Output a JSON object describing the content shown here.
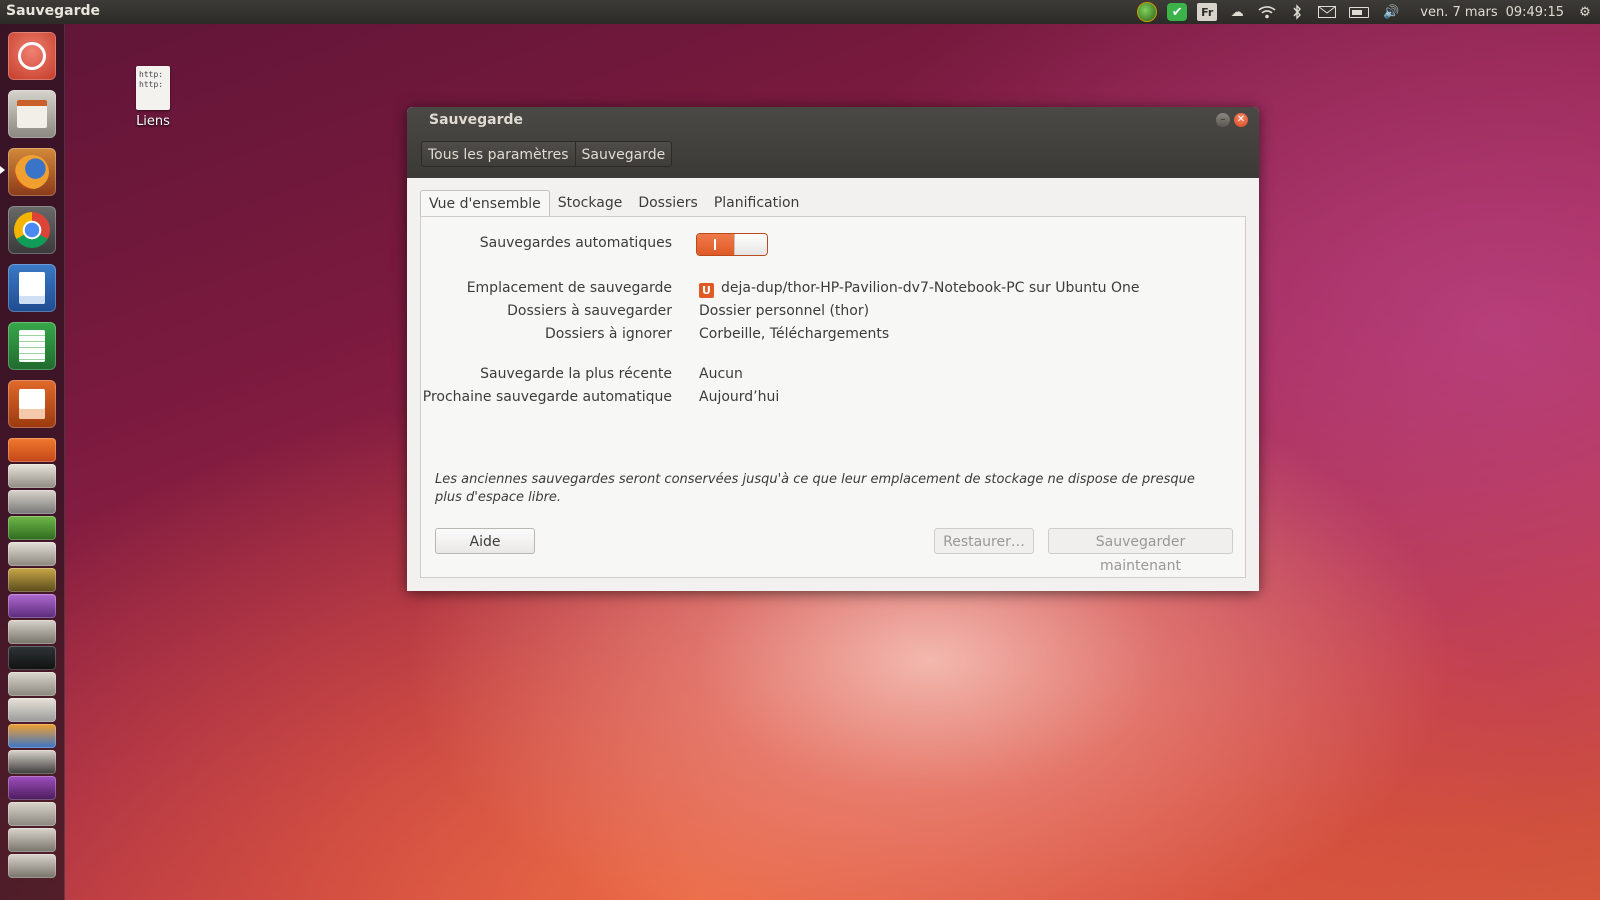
{
  "top_panel": {
    "app_title": "Sauvegarde",
    "keyboard_layout": "Fr",
    "date": "ven. 7 mars",
    "time": "09:49:15"
  },
  "desktop": {
    "icon_label": "Liens",
    "icon_preview": "http:\nhttp:"
  },
  "window": {
    "title": "Sauvegarde",
    "breadcrumbs": [
      "Tous les paramètres",
      "Sauvegarde"
    ],
    "tabs": [
      "Vue d'ensemble",
      "Stockage",
      "Dossiers",
      "Planification"
    ],
    "active_tab": "Vue d'ensemble",
    "overview": {
      "auto_backups_label": "Sauvegardes automatiques",
      "auto_backups_on": true,
      "location_label": "Emplacement de sauvegarde",
      "location_icon": "U",
      "location_value": "deja-dup/thor-HP-Pavilion-dv7-Notebook-PC sur Ubuntu One",
      "folders_save_label": "Dossiers à sauvegarder",
      "folders_save_value": "Dossier personnel (thor)",
      "folders_ignore_label": "Dossiers à ignorer",
      "folders_ignore_value": "Corbeille, Téléchargements",
      "last_backup_label": "Sauvegarde la plus récente",
      "last_backup_value": "Aucun",
      "next_backup_label": "Prochaine sauvegarde automatique",
      "next_backup_value": "Aujourd’hui",
      "note": "Les anciennes sauvegardes seront conservées jusqu'à ce que leur emplacement de stockage ne dispose de presque plus d'espace libre."
    },
    "buttons": {
      "help": "Aide",
      "restore": "Restaurer…",
      "backup_now": "Sauvegarder maintenant"
    }
  },
  "colors": {
    "accent": "#de5a26",
    "panel_bg": "#3c3b37"
  }
}
